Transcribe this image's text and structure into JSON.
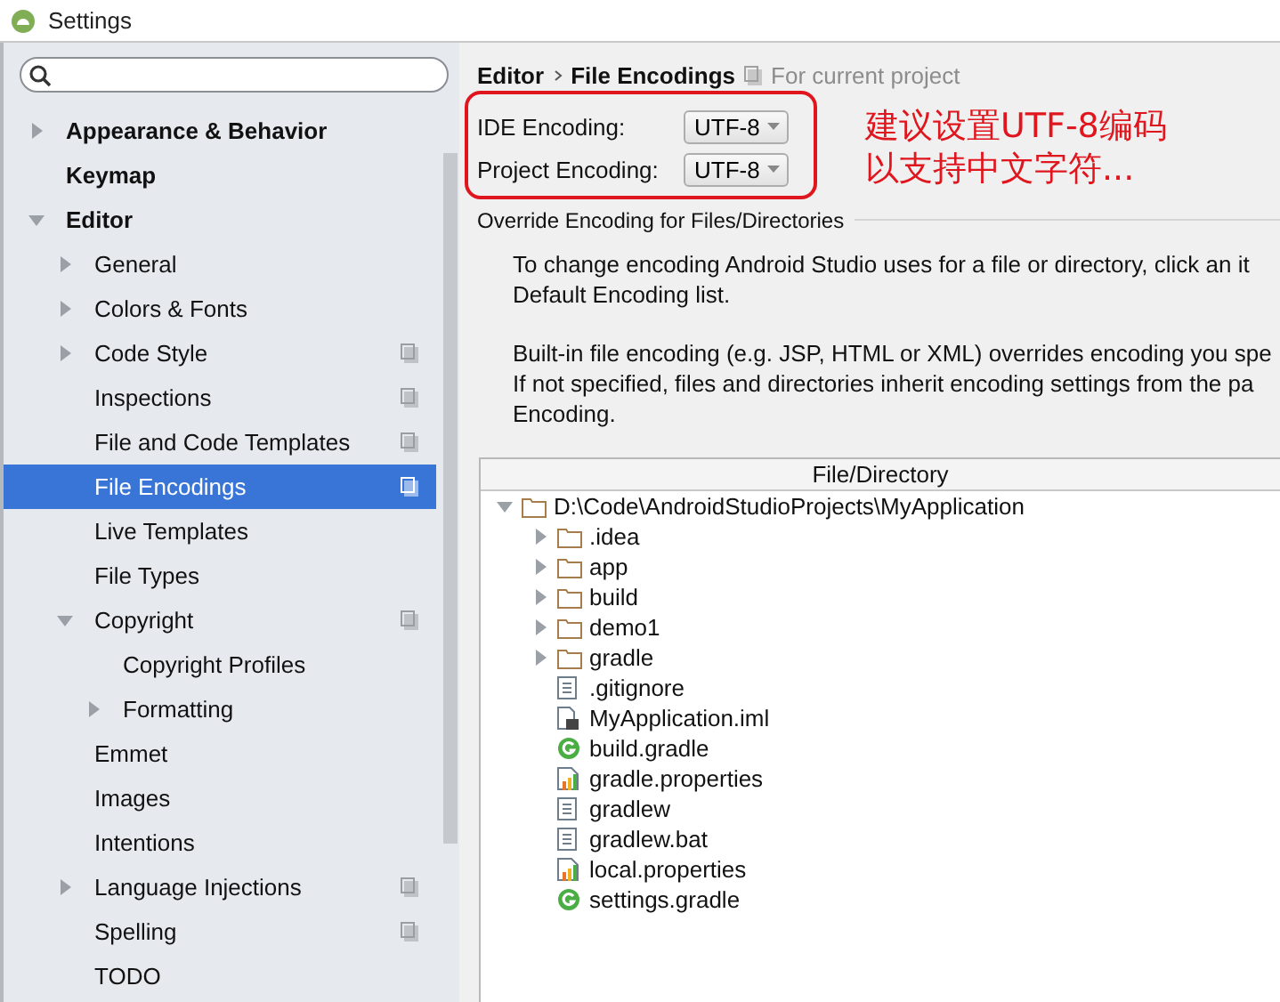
{
  "window": {
    "title": "Settings"
  },
  "sidebar": {
    "items": [
      {
        "label": "Appearance & Behavior",
        "kind": "branch",
        "expanded": false,
        "selected": false,
        "project_scope": false
      },
      {
        "label": "Keymap",
        "kind": "leaf",
        "selected": false,
        "project_scope": false
      },
      {
        "label": "Editor",
        "kind": "branch",
        "expanded": true,
        "selected": false,
        "project_scope": false,
        "children": [
          {
            "label": "General",
            "kind": "branch",
            "expanded": false,
            "selected": false,
            "project_scope": false
          },
          {
            "label": "Colors & Fonts",
            "kind": "branch",
            "expanded": false,
            "selected": false,
            "project_scope": false
          },
          {
            "label": "Code Style",
            "kind": "branch",
            "expanded": false,
            "selected": false,
            "project_scope": true
          },
          {
            "label": "Inspections",
            "kind": "leaf",
            "selected": false,
            "project_scope": true
          },
          {
            "label": "File and Code Templates",
            "kind": "leaf",
            "selected": false,
            "project_scope": true
          },
          {
            "label": "File Encodings",
            "kind": "leaf",
            "selected": true,
            "project_scope": true
          },
          {
            "label": "Live Templates",
            "kind": "leaf",
            "selected": false,
            "project_scope": false
          },
          {
            "label": "File Types",
            "kind": "leaf",
            "selected": false,
            "project_scope": false
          },
          {
            "label": "Copyright",
            "kind": "branch",
            "expanded": true,
            "selected": false,
            "project_scope": true,
            "children": [
              {
                "label": "Copyright Profiles",
                "kind": "leaf",
                "selected": false,
                "project_scope": false
              },
              {
                "label": "Formatting",
                "kind": "branch",
                "expanded": false,
                "selected": false,
                "project_scope": false
              }
            ]
          },
          {
            "label": "Emmet",
            "kind": "leaf",
            "selected": false,
            "project_scope": false
          },
          {
            "label": "Images",
            "kind": "leaf",
            "selected": false,
            "project_scope": false
          },
          {
            "label": "Intentions",
            "kind": "leaf",
            "selected": false,
            "project_scope": false
          },
          {
            "label": "Language Injections",
            "kind": "branch",
            "expanded": false,
            "selected": false,
            "project_scope": true
          },
          {
            "label": "Spelling",
            "kind": "leaf",
            "selected": false,
            "project_scope": true
          },
          {
            "label": "TODO",
            "kind": "leaf",
            "selected": false,
            "project_scope": false
          }
        ]
      }
    ]
  },
  "panel": {
    "breadcrumb": [
      "Editor",
      "File Encodings"
    ],
    "scope_note": "For current project",
    "encodings": [
      {
        "label": "IDE Encoding:",
        "value": "UTF-8"
      },
      {
        "label": "Project Encoding:",
        "value": "UTF-8"
      }
    ],
    "annotation": {
      "lines": [
        "建议设置UTF-8编码",
        "以支持中文字符..."
      ]
    },
    "section_title": "Override Encoding for Files/Directories",
    "paragraphs": [
      [
        "To change encoding Android Studio uses for a file or directory, click an it",
        "Default Encoding list."
      ],
      [
        "Built-in file encoding (e.g. JSP, HTML or XML) overrides encoding you spe",
        "If not specified, files and directories inherit encoding settings from the pa",
        "Encoding."
      ]
    ],
    "table": {
      "columns": [
        "File/Directory"
      ],
      "rows": [
        {
          "name": "D:\\Code\\AndroidStudioProjects\\MyApplication",
          "kind": "folder",
          "expanded": true,
          "children": [
            {
              "name": ".idea",
              "kind": "folder",
              "expanded": false
            },
            {
              "name": "app",
              "kind": "folder",
              "expanded": false
            },
            {
              "name": "build",
              "kind": "folder",
              "expanded": false
            },
            {
              "name": "demo1",
              "kind": "folder",
              "expanded": false
            },
            {
              "name": "gradle",
              "kind": "folder",
              "expanded": false
            },
            {
              "name": ".gitignore",
              "kind": "text"
            },
            {
              "name": "MyApplication.iml",
              "kind": "module"
            },
            {
              "name": "build.gradle",
              "kind": "gradle"
            },
            {
              "name": "gradle.properties",
              "kind": "properties"
            },
            {
              "name": "gradlew",
              "kind": "text"
            },
            {
              "name": "gradlew.bat",
              "kind": "text"
            },
            {
              "name": "local.properties",
              "kind": "properties"
            },
            {
              "name": "settings.gradle",
              "kind": "gradle"
            }
          ]
        }
      ]
    }
  }
}
